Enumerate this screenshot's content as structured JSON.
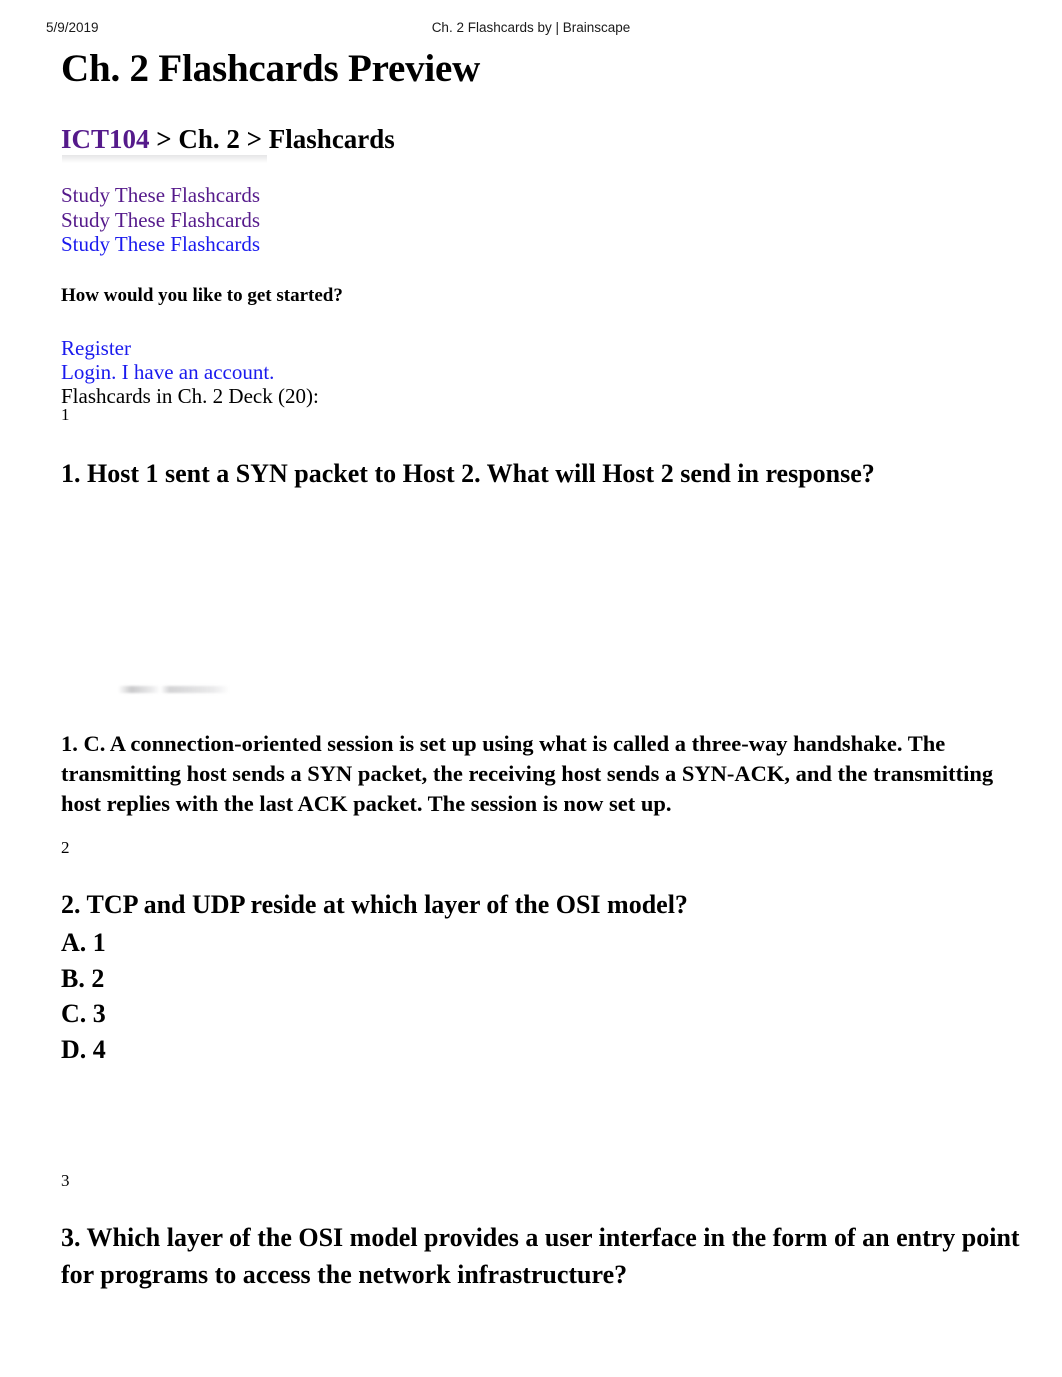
{
  "print_header": {
    "date": "5/9/2019",
    "title": "Ch. 2 Flashcards by | Brainscape"
  },
  "page": {
    "title": "Ch. 2 Flashcards Preview"
  },
  "breadcrumb": {
    "course": "ICT104",
    "rest": " > Ch. 2 > Flashcards",
    "course_color": "#551a8b"
  },
  "study_links": [
    {
      "label": "Study These Flashcards",
      "state": "visited",
      "color": "#551a8b"
    },
    {
      "label": "Study These Flashcards",
      "state": "visited",
      "color": "#551a8b"
    },
    {
      "label": "Study These Flashcards",
      "state": "unvisited",
      "color": "#1a1aee"
    }
  ],
  "prompt": {
    "get_started": "How would you like to get started?"
  },
  "account_links": [
    {
      "label": "Register",
      "color": "#1a1aee"
    },
    {
      "label": "Login. I have an account.",
      "color": "#1a1aee"
    }
  ],
  "deck": {
    "count_label": "Flashcards in Ch. 2 Deck (20):"
  },
  "cards": [
    {
      "index": "1",
      "question": "1. Host 1 sent a SYN packet to Host 2. What will Host 2 send in response?",
      "choices": [],
      "answer": "1. C. A connection-oriented session is set up using what is called a three-way handshake. The transmitting host sends a SYN packet, the receiving host sends a SYN-ACK, and the transmitting host replies with the last ACK packet. The session is now set up."
    },
    {
      "index": "2",
      "question": "2. TCP and UDP reside at which layer of the OSI model?",
      "choices": [
        "A. 1",
        "B. 2",
        "C. 3",
        "D. 4"
      ],
      "answer": ""
    },
    {
      "index": "3",
      "question": "3. Which layer of the OSI model provides a user interface in the form of an entry point for programs to access the network infrastructure?",
      "choices": [],
      "answer": ""
    }
  ]
}
